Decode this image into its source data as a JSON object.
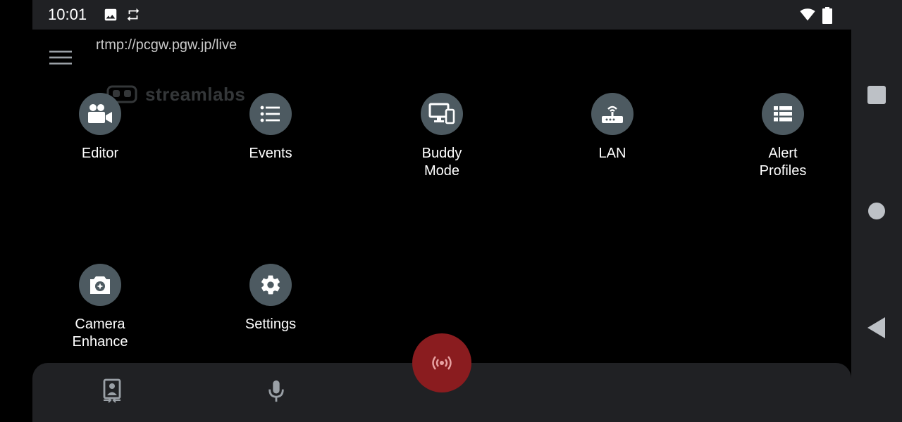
{
  "status_bar": {
    "time": "10:01",
    "icons": [
      "image-icon",
      "sync-icon",
      "wifi-icon",
      "battery-icon"
    ]
  },
  "app": {
    "rtmp_url": "rtmp://pcgw.pgw.jp/live",
    "watermark": "streamlabs",
    "tiles": [
      {
        "label": "Editor",
        "icon": "video-camera-icon"
      },
      {
        "label": "Events",
        "icon": "list-icon"
      },
      {
        "label": "Buddy\nMode",
        "icon": "devices-icon"
      },
      {
        "label": "LAN",
        "icon": "router-icon"
      },
      {
        "label": "Alert\nProfiles",
        "icon": "view-list-icon"
      },
      {
        "label": "Camera\nEnhance",
        "icon": "camera-enhance-icon"
      },
      {
        "label": "Settings",
        "icon": "gear-icon"
      }
    ],
    "bottom_bar": {
      "icons": [
        "camera-switch-icon",
        "microphone-icon"
      ],
      "go_live_icon": "broadcast-icon"
    }
  },
  "colors": {
    "background": "#000000",
    "bar": "#202124",
    "tile_circle": "#4d5a61",
    "go_live": "#8a1c1f"
  },
  "nav_bar": {
    "buttons": [
      "recents-button",
      "home-button",
      "back-button"
    ]
  }
}
